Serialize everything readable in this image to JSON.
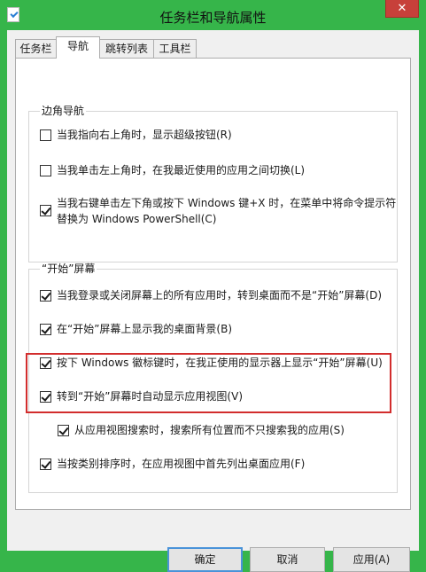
{
  "window": {
    "title": "任务栏和导航属性",
    "close_label": "✕"
  },
  "tabs": [
    {
      "label": "任务栏",
      "active": false
    },
    {
      "label": "导航",
      "active": true
    },
    {
      "label": "跳转列表",
      "active": false
    },
    {
      "label": "工具栏",
      "active": false
    }
  ],
  "corner_nav": {
    "title": "边角导航",
    "options": [
      {
        "label": "当我指向右上角时，显示超级按钮(R)",
        "checked": false
      },
      {
        "label": "当我单击左上角时，在我最近使用的应用之间切换(L)",
        "checked": false
      },
      {
        "label_line1": "当我右键单击左下角或按下 Windows 键+X 时，在菜单中将命令提示符",
        "label_line2": "替换为 Windows PowerShell(C)",
        "checked": true
      }
    ]
  },
  "start_screen": {
    "title": "“开始”屏幕",
    "options": [
      {
        "label": "当我登录或关闭屏幕上的所有应用时，转到桌面而不是“开始”屏幕(D)",
        "checked": true
      },
      {
        "label": "在“开始”屏幕上显示我的桌面背景(B)",
        "checked": true
      },
      {
        "label": "按下 Windows 徽标键时，在我正使用的显示器上显示“开始”屏幕(U)",
        "checked": true
      },
      {
        "label": "转到“开始”屏幕时自动显示应用视图(V)",
        "checked": true
      },
      {
        "label": "从应用视图搜索时，搜索所有位置而不只搜索我的应用(S)",
        "checked": true
      },
      {
        "label": "当按类别排序时，在应用视图中首先列出桌面应用(F)",
        "checked": true
      }
    ]
  },
  "buttons": {
    "ok": "确定",
    "cancel": "取消",
    "apply": "应用(A)"
  },
  "colors": {
    "frame": "#36b54a",
    "close": "#c7403a",
    "highlight": "#d22d2d"
  }
}
